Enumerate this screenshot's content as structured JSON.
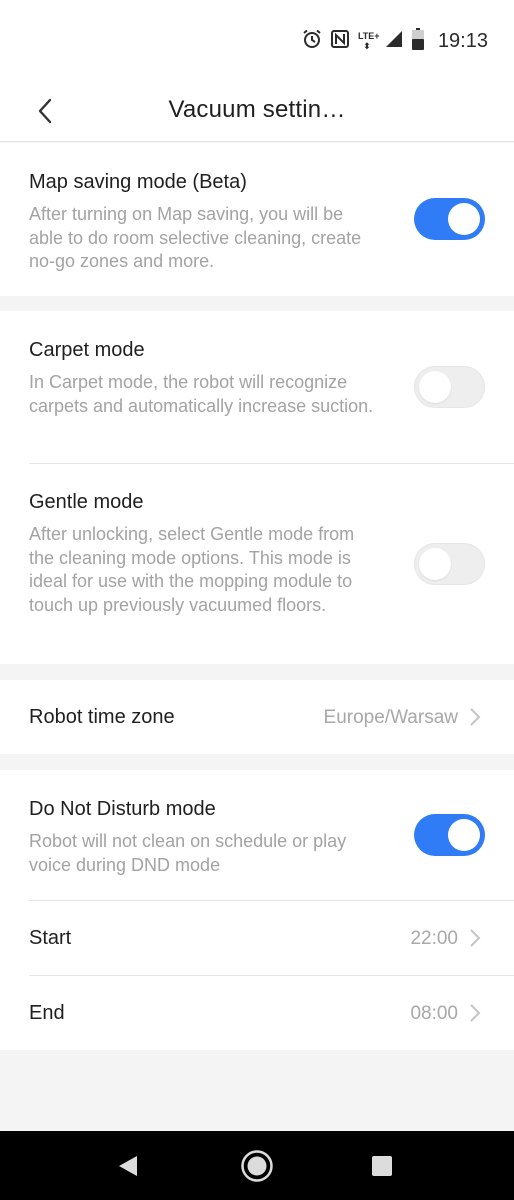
{
  "status_bar": {
    "time": "19:13",
    "network": "LTE+",
    "icons": [
      "alarm-icon",
      "nfc-icon",
      "lte-icon",
      "signal-icon",
      "battery-icon"
    ]
  },
  "header": {
    "title": "Vacuum settin…",
    "back_icon": "back-chevron-icon"
  },
  "settings": {
    "map_saving": {
      "title": "Map saving mode (Beta)",
      "description": "After turning on Map saving, you will be able to do room selective cleaning, create no-go zones and more.",
      "enabled": true
    },
    "carpet": {
      "title": "Carpet mode",
      "description": "In Carpet mode, the robot will recognize carpets and automatically increase suction.",
      "enabled": false
    },
    "gentle": {
      "title": "Gentle mode",
      "description": "After unlocking, select Gentle mode from the cleaning mode options. This mode is ideal for use with the mopping module to touch up previously vacuumed floors.",
      "enabled": false
    },
    "time_zone": {
      "title": "Robot time zone",
      "value": "Europe/Warsaw"
    },
    "dnd": {
      "title": "Do Not Disturb mode",
      "description": "Robot will not clean on schedule or play voice during DND mode",
      "enabled": true,
      "start_label": "Start",
      "start_value": "22:00",
      "end_label": "End",
      "end_value": "08:00"
    }
  },
  "colors": {
    "accent": "#2f7cf6",
    "toggle_off": "#eeeeee",
    "secondary_text": "#a3a3a3",
    "background": "#f4f4f4"
  },
  "nav_bar": {
    "icons": [
      "back-triangle-icon",
      "home-circle-icon",
      "recents-square-icon"
    ]
  }
}
